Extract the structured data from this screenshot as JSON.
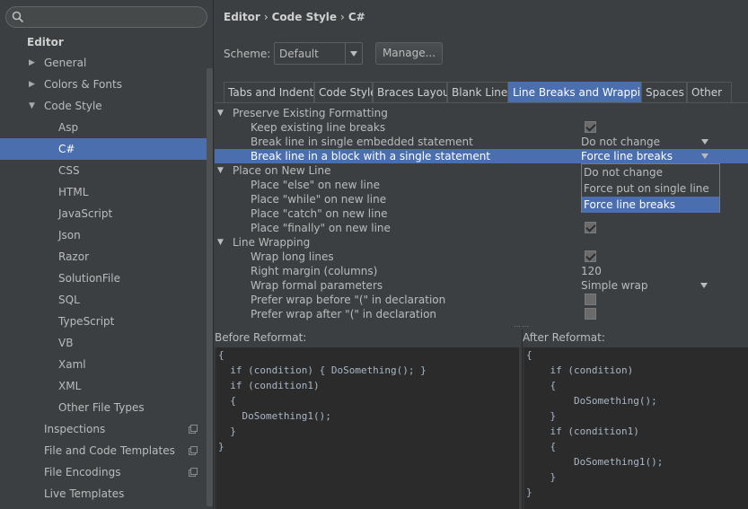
{
  "search": {
    "placeholder": ""
  },
  "sidebar": {
    "header": "Editor",
    "items": [
      {
        "label": "General"
      },
      {
        "label": "Colors & Fonts"
      },
      {
        "label": "Code Style"
      },
      {
        "label": "Asp"
      },
      {
        "label": "C#"
      },
      {
        "label": "CSS"
      },
      {
        "label": "HTML"
      },
      {
        "label": "JavaScript"
      },
      {
        "label": "Json"
      },
      {
        "label": "Razor"
      },
      {
        "label": "SolutionFile"
      },
      {
        "label": "SQL"
      },
      {
        "label": "TypeScript"
      },
      {
        "label": "VB"
      },
      {
        "label": "Xaml"
      },
      {
        "label": "XML"
      },
      {
        "label": "Other File Types"
      },
      {
        "label": "Inspections"
      },
      {
        "label": "File and Code Templates"
      },
      {
        "label": "File Encodings"
      },
      {
        "label": "Live Templates"
      }
    ]
  },
  "breadcrumb": {
    "a": "Editor",
    "b": "Code Style",
    "c": "C#",
    "sep": "›"
  },
  "scheme": {
    "label": "Scheme:",
    "value": "Default",
    "manage": "Manage..."
  },
  "tabs": [
    "Tabs and Indents",
    "Code Style",
    "Braces Layout",
    "Blank Lines",
    "Line Breaks and Wrapping",
    "Spaces",
    "Other"
  ],
  "options": [
    {
      "name": "Preserve Existing Formatting"
    },
    {
      "name": "Keep existing line breaks",
      "checked": true
    },
    {
      "name": "Break line in single embedded statement",
      "value": "Do not change"
    },
    {
      "name": "Break line in a block with a single statement",
      "value": "Force line breaks"
    },
    {
      "name": "Place on New Line"
    },
    {
      "name": "Place \"else\" on new line"
    },
    {
      "name": "Place \"while\" on new line"
    },
    {
      "name": "Place \"catch\" on new line"
    },
    {
      "name": "Place \"finally\" on new line",
      "checked": true
    },
    {
      "name": "Line Wrapping"
    },
    {
      "name": "Wrap long lines",
      "checked": true
    },
    {
      "name": "Right margin (columns)",
      "value": "120"
    },
    {
      "name": "Wrap formal parameters",
      "value": "Simple wrap"
    },
    {
      "name": "Prefer wrap before \"(\" in declaration",
      "checked": false
    },
    {
      "name": "Prefer wrap after \"(\" in declaration",
      "checked": false
    }
  ],
  "popup": [
    "Do not change",
    "Force put on single line",
    "Force line breaks"
  ],
  "before": {
    "title": "Before Reformat:",
    "lines": [
      "{",
      "  if (condition) { DoSomething(); }",
      "  if (condition1)",
      "  {",
      "    DoSomething1();",
      "  }",
      "}"
    ]
  },
  "after": {
    "title": "After Reformat:",
    "lines": [
      "{",
      "    if (condition)",
      "    {",
      "        DoSomething();",
      "    }",
      "    if (condition1)",
      "    {",
      "        DoSomething1();",
      "    }",
      "}"
    ]
  },
  "colors": {
    "selection": "#4b6eaf",
    "panel": "#3c3f41",
    "editor": "#2b2b2b"
  }
}
